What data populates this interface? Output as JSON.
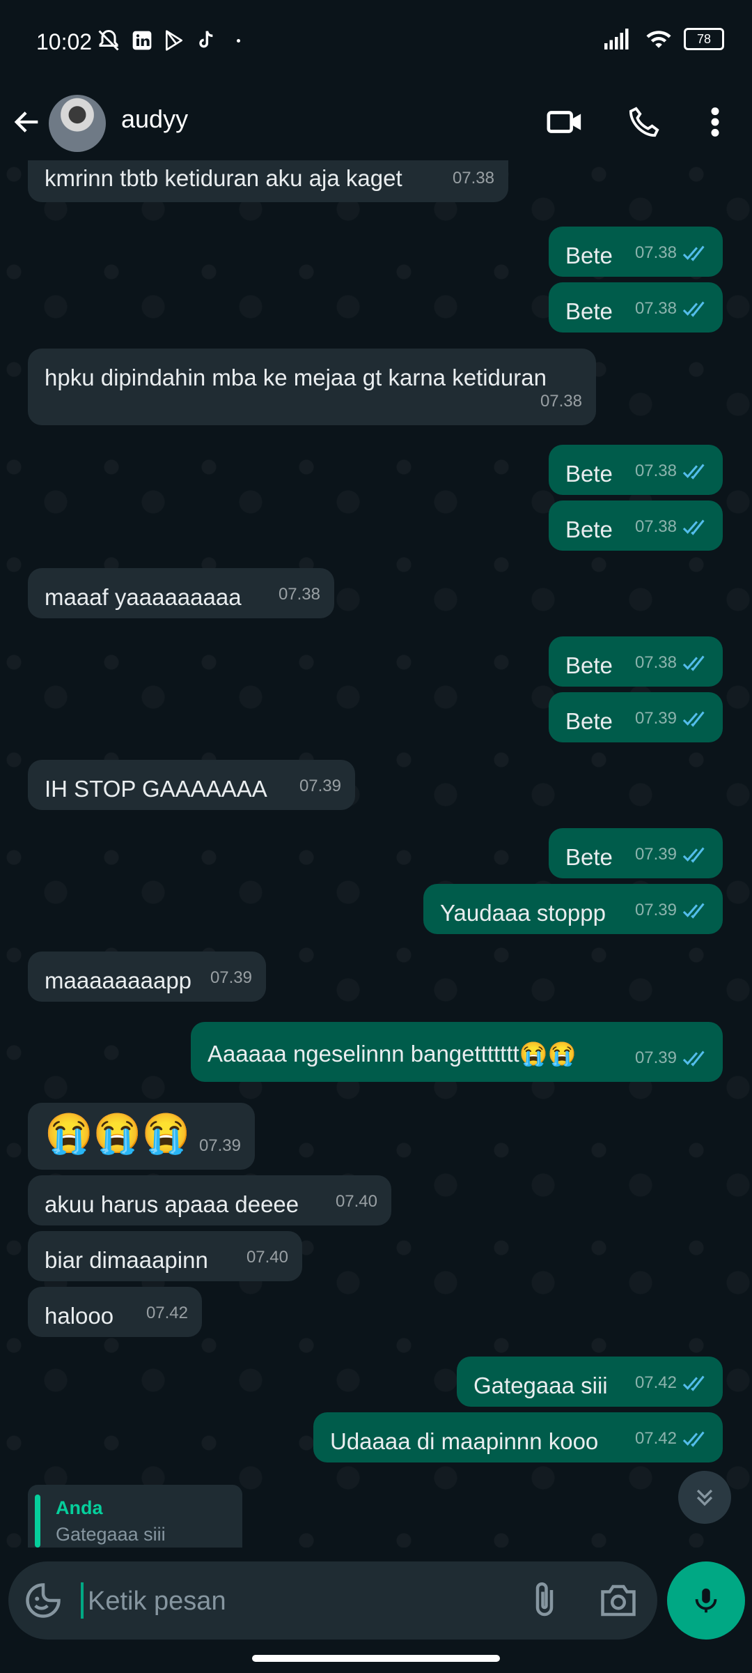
{
  "status_bar": {
    "time": "10:02",
    "battery": "78"
  },
  "header": {
    "contact_name": "audyy"
  },
  "messages": [
    {
      "dir": "in",
      "text": "kmrinn tbtb ketiduran aku aja kaget",
      "time": "07.38"
    },
    {
      "dir": "out",
      "text": "Bete",
      "time": "07.38"
    },
    {
      "dir": "out",
      "text": "Bete",
      "time": "07.38"
    },
    {
      "dir": "in",
      "text": "hpku dipindahin mba ke mejaa gt karna ketiduran",
      "time": "07.38"
    },
    {
      "dir": "out",
      "text": "Bete",
      "time": "07.38"
    },
    {
      "dir": "out",
      "text": "Bete",
      "time": "07.38"
    },
    {
      "dir": "in",
      "text": "maaaf yaaaaaaaaa",
      "time": "07.38"
    },
    {
      "dir": "out",
      "text": "Bete",
      "time": "07.38"
    },
    {
      "dir": "out",
      "text": "Bete",
      "time": "07.39"
    },
    {
      "dir": "in",
      "text": "IH STOP GAAAAAAA",
      "time": "07.39"
    },
    {
      "dir": "out",
      "text": "Bete",
      "time": "07.39"
    },
    {
      "dir": "out",
      "text": "Yaudaaa stoppp",
      "time": "07.39"
    },
    {
      "dir": "in",
      "text": "maaaaaaaapp",
      "time": "07.39"
    },
    {
      "dir": "out",
      "text": "Aaaaaa ngeselinnn bangettttttt😭😭",
      "time": "07.39"
    },
    {
      "dir": "in",
      "text": "😭😭😭",
      "time": "07.39"
    },
    {
      "dir": "in",
      "text": "akuu harus apaaa deeee",
      "time": "07.40"
    },
    {
      "dir": "in",
      "text": "biar dimaaapinn",
      "time": "07.40"
    },
    {
      "dir": "in",
      "text": "halooo",
      "time": "07.42"
    },
    {
      "dir": "out",
      "text": "Gategaaa siii",
      "time": "07.42"
    },
    {
      "dir": "out",
      "text": "Udaaaa di maapinnn kooo",
      "time": "07.42"
    }
  ],
  "reply_preview": {
    "author": "Anda",
    "text": "Gategaaa siii"
  },
  "composer": {
    "placeholder": "Ketik pesan"
  },
  "colors": {
    "accent": "#00a884",
    "outgoing_bubble": "#005c4b",
    "incoming_bubble": "#202c33",
    "read_tick": "#53bdeb"
  }
}
